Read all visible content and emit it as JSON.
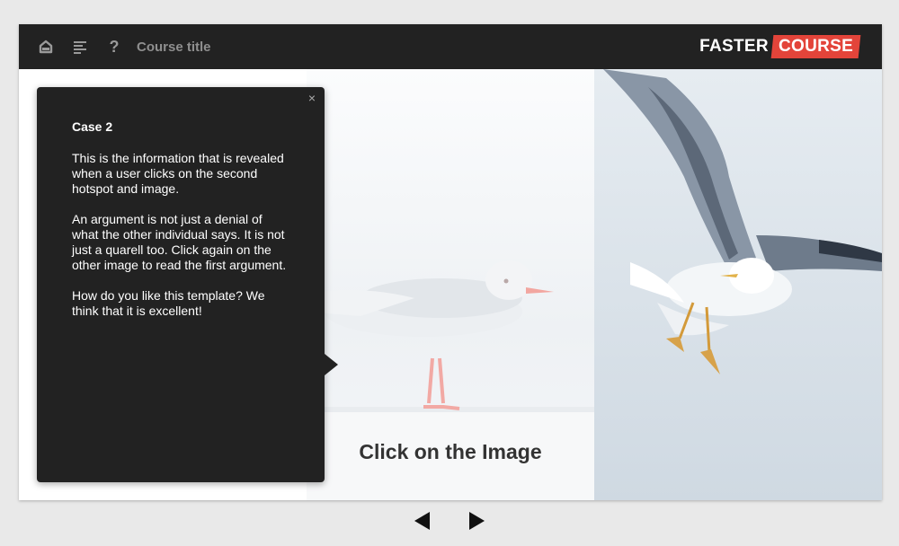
{
  "header": {
    "course_title": "Course title",
    "icons": [
      "home-icon",
      "menu-lines-icon",
      "help-icon"
    ],
    "help_glyph": "?"
  },
  "logo": {
    "word1": "FASTER",
    "word2": "COURSE",
    "accent_color": "#e3443a"
  },
  "popup": {
    "close_glyph": "×",
    "title": "Case 2",
    "paragraphs": [
      "This is the information that is revealed when a user clicks on the second hotspot and image.",
      "An argument is not just a denial of what the other individual says. It is not just a quarell too. Click again on the other image to read the first argument.",
      "How do you like this template? We think that it is excellent!"
    ]
  },
  "main": {
    "cta": "Click on the Image"
  },
  "nav": {
    "icons": [
      "prev-arrow-icon",
      "next-arrow-icon"
    ]
  },
  "colors": {
    "topbar": "#222222",
    "background": "#e9e9e9",
    "popup": "#222222"
  }
}
